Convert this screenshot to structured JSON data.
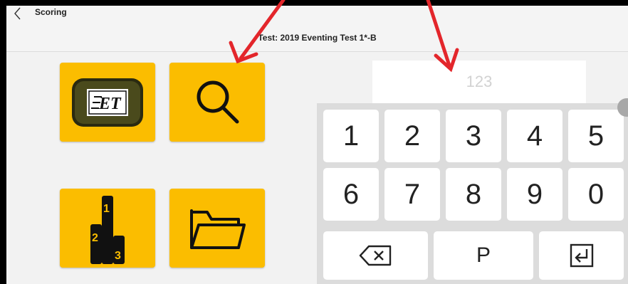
{
  "header": {
    "back_icon": "chevron-left-icon",
    "app_title": "Scoring",
    "test_title": "Test: 2019 Eventing Test 1*-B"
  },
  "tiles": [
    {
      "name": "et-logo-tile",
      "icon": "et-logo-icon",
      "logo_text": "ET"
    },
    {
      "name": "search-tile",
      "icon": "search-icon"
    },
    {
      "name": "results-podium-tile",
      "icon": "podium-icon",
      "podium_labels": [
        "2",
        "1",
        "3"
      ]
    },
    {
      "name": "folder-tile",
      "icon": "folder-icon"
    }
  ],
  "competitor_input": {
    "value": "",
    "placeholder": "123"
  },
  "keypad": {
    "row1": [
      "1",
      "2",
      "3",
      "4",
      "5"
    ],
    "row2": [
      "6",
      "7",
      "8",
      "9",
      "0"
    ],
    "backspace_icon": "backspace-icon",
    "p_label": "P",
    "enter_icon": "enter-icon"
  },
  "colors": {
    "tile": "#fbbd00",
    "arrow": "#e3262b",
    "keypad_bg": "#dcdcdc",
    "screen_bg": "#f2f2f2"
  },
  "annotations": {
    "arrow_color": "#e3262b",
    "arrow_count": 2
  }
}
